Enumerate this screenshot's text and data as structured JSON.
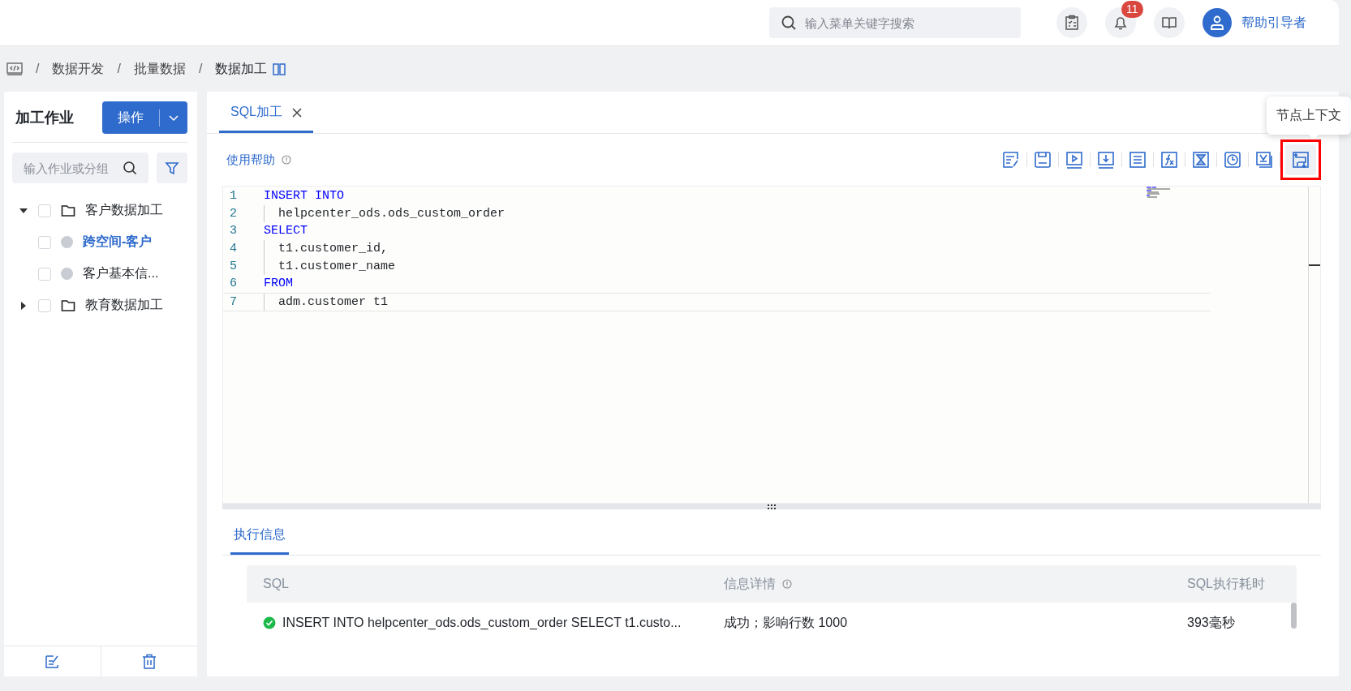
{
  "header": {
    "search": {
      "placeholder": "输入菜单关键字搜索"
    },
    "notifications": {
      "badge": "11"
    },
    "user": {
      "name": "帮助引导者"
    }
  },
  "breadcrumb": [
    {
      "separator": "/",
      "label": "数据开发",
      "current": false
    },
    {
      "separator": "/",
      "label": "批量数据",
      "current": false
    },
    {
      "separator": "/",
      "label": "数据加工",
      "current": true
    }
  ],
  "sidebar": {
    "title": "加工作业",
    "action_button": "操作",
    "search": {
      "placeholder": "输入作业或分组"
    },
    "tree": [
      {
        "kind": "folder",
        "label": "客户数据加工",
        "expanded": true,
        "checked": false,
        "selected": false,
        "children": [
          {
            "kind": "job",
            "label": "跨空间-客户",
            "checked": false,
            "selected": true
          },
          {
            "kind": "job",
            "label": "客户基本信...",
            "checked": false,
            "selected": false
          }
        ]
      },
      {
        "kind": "folder",
        "label": "教育数据加工",
        "expanded": false,
        "checked": false,
        "selected": false
      }
    ]
  },
  "editor_tabs": [
    {
      "label": "SQL加工",
      "selected": true
    }
  ],
  "help_link": "使用帮助",
  "toolbar": [
    {
      "kind": "edit",
      "highlighted": false
    },
    {
      "kind": "save",
      "highlighted": false
    },
    {
      "kind": "run",
      "highlighted": false
    },
    {
      "kind": "download",
      "highlighted": false
    },
    {
      "kind": "list",
      "highlighted": false
    },
    {
      "kind": "function",
      "highlighted": false
    },
    {
      "kind": "hourglass",
      "highlighted": false
    },
    {
      "kind": "clock",
      "highlighted": false
    },
    {
      "kind": "version",
      "highlighted": false
    },
    {
      "kind": "context",
      "highlighted": true,
      "tooltip": "节点上下文"
    }
  ],
  "code": [
    {
      "number": "1",
      "text": "INSERT INTO",
      "kind": "keyword",
      "current": false
    },
    {
      "number": "2",
      "text": "helpcenter_ods.ods_custom_order",
      "kind": "plain",
      "current": false
    },
    {
      "number": "3",
      "text": "SELECT",
      "kind": "keyword",
      "current": false
    },
    {
      "number": "4",
      "text": "t1.customer_id,",
      "kind": "plain",
      "current": false
    },
    {
      "number": "5",
      "text": "t1.customer_name",
      "kind": "plain",
      "current": false
    },
    {
      "number": "6",
      "text": "FROM",
      "kind": "keyword",
      "current": false
    },
    {
      "number": "7",
      "text": "adm.customer t1",
      "kind": "plain",
      "current": true
    }
  ],
  "results": {
    "tabs": [
      {
        "label": "执行信息",
        "selected": true
      }
    ],
    "columns": [
      {
        "label": "SQL",
        "info": false
      },
      {
        "label": "信息详情",
        "info": true
      },
      {
        "label": "SQL执行耗时",
        "info": false
      }
    ],
    "rows": [
      {
        "kind": "success",
        "sql": "INSERT INTO helpcenter_ods.ods_custom_order SELECT t1.custo...",
        "detail": "成功；影响行数 1000",
        "duration": "393毫秒"
      }
    ]
  }
}
